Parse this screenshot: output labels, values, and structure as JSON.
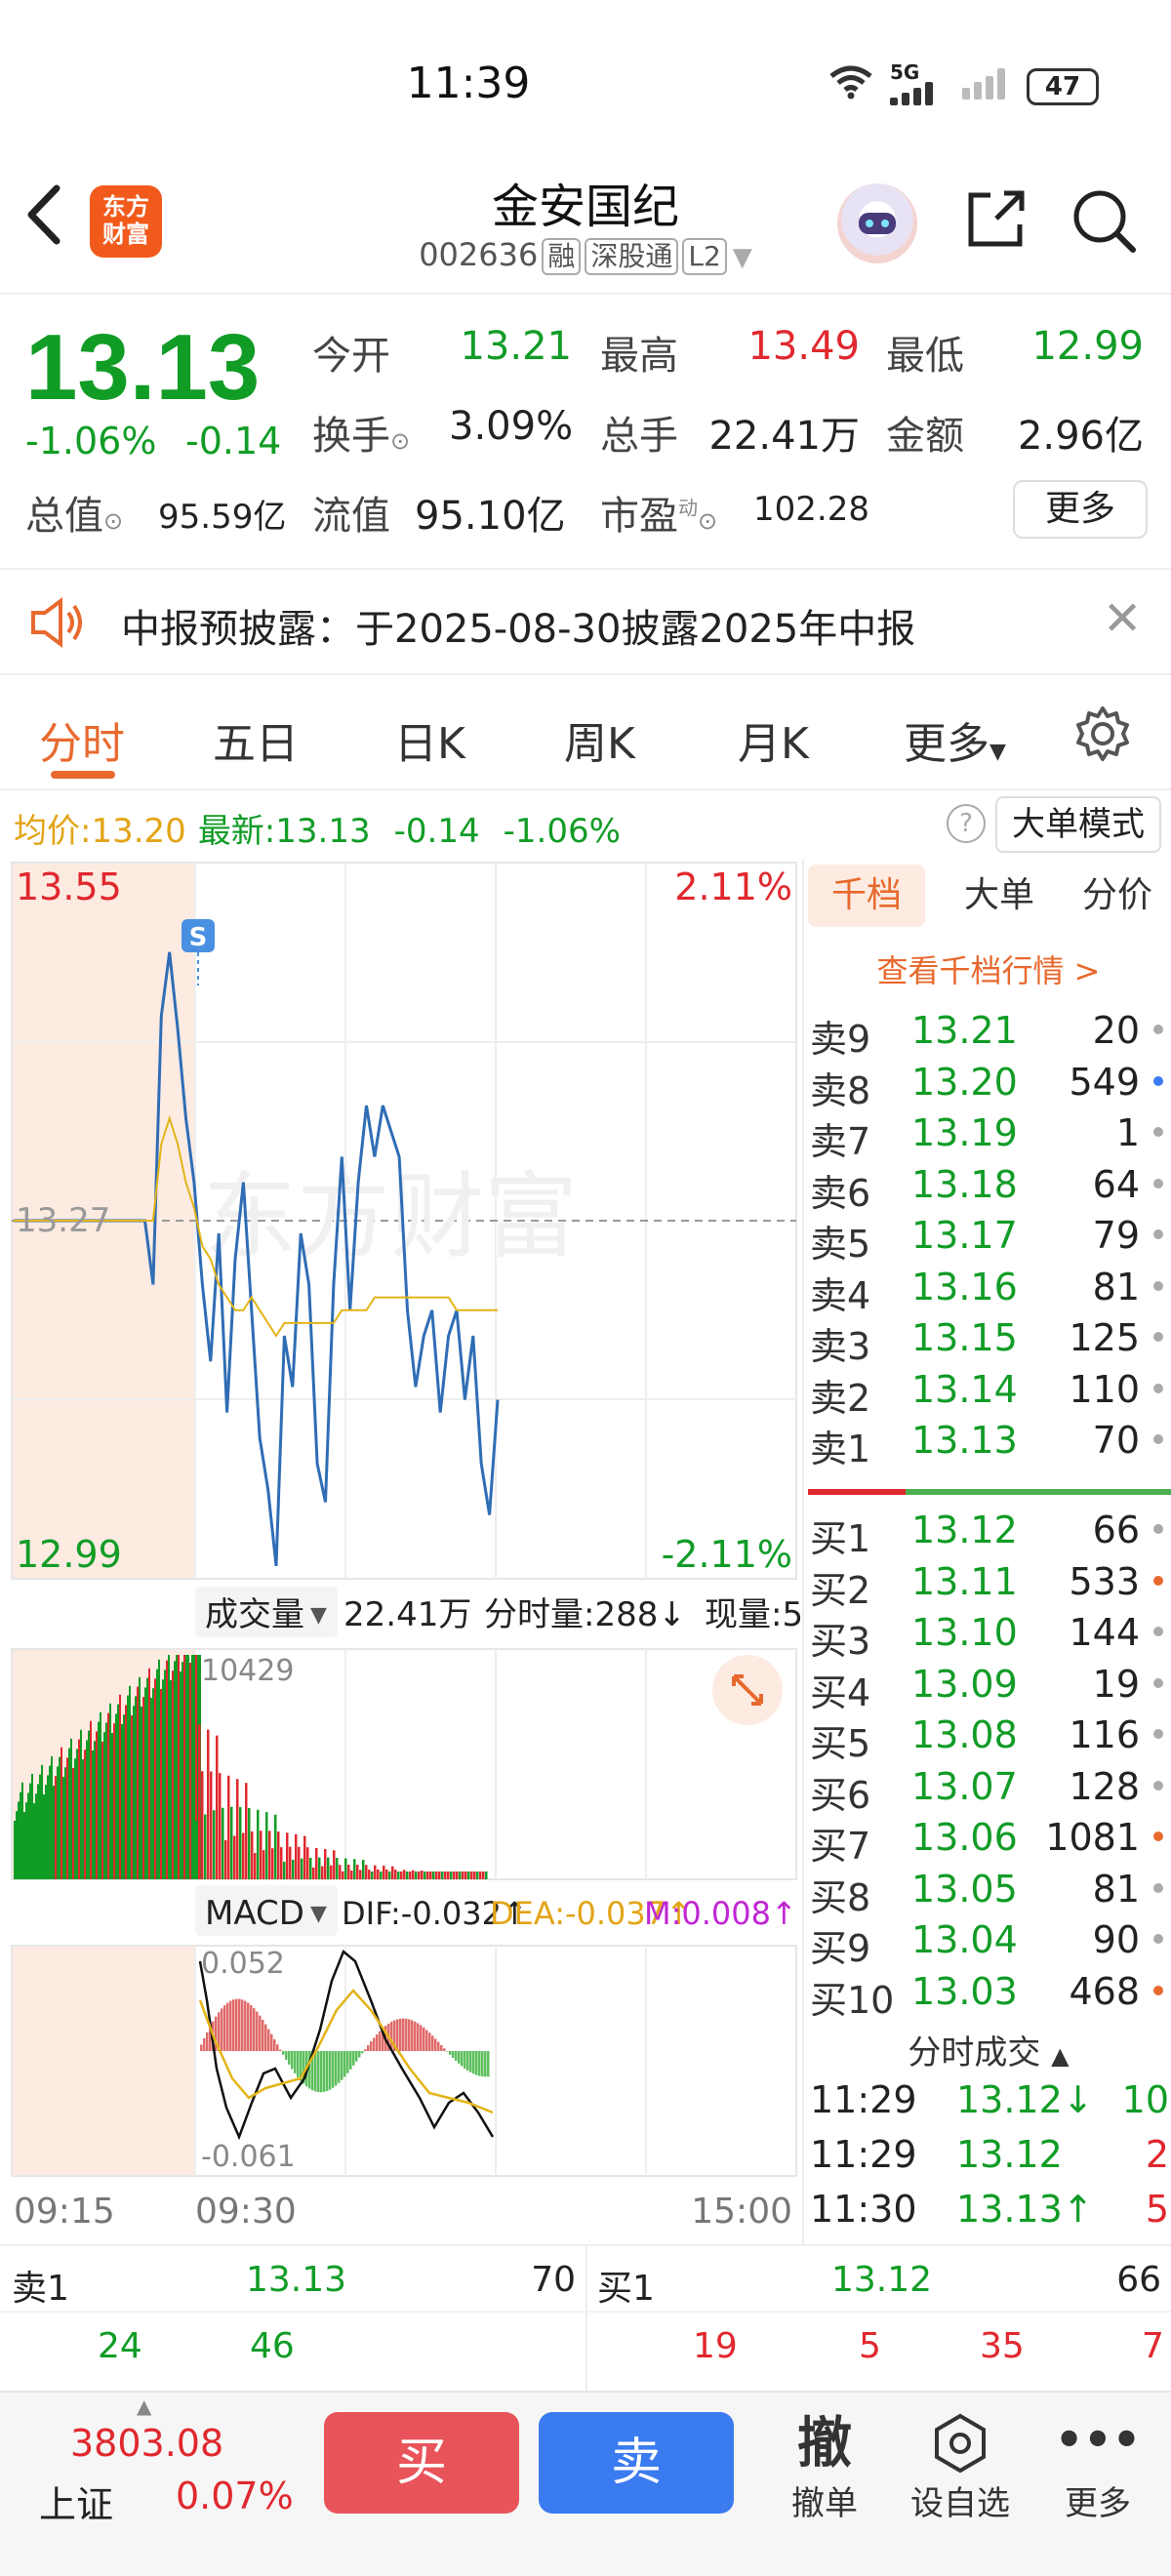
{
  "status_bar": {
    "time": "11:39",
    "network": "5G",
    "battery": "47"
  },
  "header": {
    "logo_text": "东方财富",
    "stock_name": "金安国纪",
    "stock_code": "002636",
    "tags": [
      "融",
      "深股通",
      "L2"
    ]
  },
  "quote": {
    "price": "13.13",
    "change_pct": "-1.06%",
    "change": "-0.14",
    "open_label": "今开",
    "open": "13.21",
    "high_label": "最高",
    "high": "13.49",
    "low_label": "最低",
    "low": "12.99",
    "turnover_label": "换手",
    "turnover": "3.09%",
    "volume_label": "总手",
    "volume": "22.41万",
    "amount_label": "金额",
    "amount": "2.96亿",
    "mktcap_label": "总值",
    "mktcap": "95.59亿",
    "float_label": "流值",
    "float_cap": "95.10亿",
    "pe_label": "市盈",
    "pe_sup": "动",
    "pe": "102.28",
    "more_label": "更多"
  },
  "notice": {
    "text": "中报预披露：于2025-08-30披露2025年中报"
  },
  "tabs": [
    "分时",
    "五日",
    "日K",
    "周K",
    "月K",
    "更多"
  ],
  "info_line": {
    "avg_label": "均价:",
    "avg": "13.20",
    "latest_label": "最新:",
    "latest": "13.13",
    "change": "-0.14",
    "change_pct": "-1.06%",
    "big_order_label": "大单模式"
  },
  "chart_data": {
    "type": "line",
    "price_top": "13.55",
    "price_bottom": "12.99",
    "price_ref": "13.27",
    "pct_top": "2.11%",
    "pct_bottom": "-2.11%",
    "ylim": [
      12.99,
      13.55
    ],
    "signal_label": "S",
    "time_axis": [
      "09:15",
      "09:30",
      "15:00"
    ],
    "series": [
      {
        "values": [
          13.27,
          13.27,
          13.27,
          13.27,
          13.27,
          13.27,
          13.27,
          13.27,
          13.27,
          13.27,
          13.27,
          13.27,
          13.27,
          13.27,
          13.27,
          13.27,
          13.27,
          13.22,
          13.43,
          13.48,
          13.42,
          13.35,
          13.3,
          13.22,
          13.16,
          13.26,
          13.12,
          13.24,
          13.3,
          13.2,
          13.1,
          13.06,
          13.0,
          13.18,
          13.14,
          13.26,
          13.22,
          13.08,
          13.05,
          13.22,
          13.32,
          13.2,
          13.3,
          13.36,
          13.32,
          13.36,
          13.34,
          13.32,
          13.2,
          13.14,
          13.18,
          13.2,
          13.12,
          13.18,
          13.2,
          13.13,
          13.18,
          13.08,
          13.04,
          13.13
        ]
      },
      {
        "values": [
          13.27,
          13.27,
          13.27,
          13.27,
          13.27,
          13.27,
          13.27,
          13.27,
          13.27,
          13.27,
          13.27,
          13.27,
          13.27,
          13.27,
          13.27,
          13.27,
          13.27,
          13.27,
          13.33,
          13.35,
          13.33,
          13.3,
          13.28,
          13.25,
          13.24,
          13.22,
          13.21,
          13.2,
          13.2,
          13.21,
          13.2,
          13.19,
          13.18,
          13.19,
          13.19,
          13.19,
          13.19,
          13.19,
          13.19,
          13.19,
          13.2,
          13.2,
          13.2,
          13.2,
          13.21,
          13.21,
          13.21,
          13.21,
          13.21,
          13.21,
          13.21,
          13.21,
          13.21,
          13.21,
          13.2,
          13.2,
          13.2,
          13.2,
          13.2,
          13.2
        ]
      }
    ],
    "volume": {
      "label": "成交量",
      "total": "22.41万",
      "per_min_label": "分时量:288↓",
      "current_label": "现量:5",
      "max": "10429"
    },
    "macd": {
      "label": "MACD",
      "dif": "DIF:-0.032↑",
      "dea": "DEA:-0.037↑",
      "m": "M:0.008↑",
      "top": "0.052",
      "bottom": "-0.061"
    }
  },
  "orderbook": {
    "tabs": [
      "千档",
      "大单",
      "分价"
    ],
    "link": "查看千档行情 >",
    "sells": [
      {
        "label": "卖9",
        "price": "13.21",
        "vol": "20",
        "dot": "#aaa"
      },
      {
        "label": "卖8",
        "price": "13.20",
        "vol": "549",
        "dot": "#3b7bf0"
      },
      {
        "label": "卖7",
        "price": "13.19",
        "vol": "1",
        "dot": "#aaa"
      },
      {
        "label": "卖6",
        "price": "13.18",
        "vol": "64",
        "dot": "#aaa"
      },
      {
        "label": "卖5",
        "price": "13.17",
        "vol": "79",
        "dot": "#aaa"
      },
      {
        "label": "卖4",
        "price": "13.16",
        "vol": "81",
        "dot": "#aaa"
      },
      {
        "label": "卖3",
        "price": "13.15",
        "vol": "125",
        "dot": "#aaa"
      },
      {
        "label": "卖2",
        "price": "13.14",
        "vol": "110",
        "dot": "#aaa"
      },
      {
        "label": "卖1",
        "price": "13.13",
        "vol": "70",
        "dot": "#aaa"
      }
    ],
    "buys": [
      {
        "label": "买1",
        "price": "13.12",
        "vol": "66",
        "dot": "#aaa"
      },
      {
        "label": "买2",
        "price": "13.11",
        "vol": "533",
        "dot": "#e8692e"
      },
      {
        "label": "买3",
        "price": "13.10",
        "vol": "144",
        "dot": "#aaa"
      },
      {
        "label": "买4",
        "price": "13.09",
        "vol": "19",
        "dot": "#aaa"
      },
      {
        "label": "买5",
        "price": "13.08",
        "vol": "116",
        "dot": "#aaa"
      },
      {
        "label": "买6",
        "price": "13.07",
        "vol": "128",
        "dot": "#aaa"
      },
      {
        "label": "买7",
        "price": "13.06",
        "vol": "1081",
        "dot": "#e8692e"
      },
      {
        "label": "买8",
        "price": "13.05",
        "vol": "81",
        "dot": "#aaa"
      },
      {
        "label": "买9",
        "price": "13.04",
        "vol": "90",
        "dot": "#aaa"
      },
      {
        "label": "买10",
        "price": "13.03",
        "vol": "468",
        "dot": "#e8692e"
      }
    ],
    "ticks_label": "分时成交",
    "ticks": [
      {
        "time": "11:29",
        "price": "13.12↓",
        "vol": "10"
      },
      {
        "time": "11:29",
        "price": "13.12",
        "vol": "2"
      },
      {
        "time": "11:30",
        "price": "13.13↑",
        "vol": "5"
      }
    ]
  },
  "bottom_quote": {
    "sell_label": "卖1",
    "sell_price": "13.13",
    "sell_vol": "70",
    "buy_label": "买1",
    "buy_price": "13.12",
    "buy_vol": "66",
    "sell_queue": [
      "24",
      "46"
    ],
    "buy_queue": [
      "19",
      "5",
      "35",
      "7"
    ]
  },
  "bottom_bar": {
    "index_value": "3803.08",
    "index_name": "上证",
    "index_pct": "0.07%",
    "buy_label": "买",
    "sell_label": "卖",
    "cancel_icon_text": "撤",
    "cancel_label": "撤单",
    "watch_label": "设自选",
    "more_label": "更多"
  }
}
